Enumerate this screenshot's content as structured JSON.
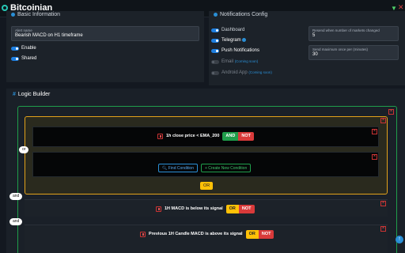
{
  "app": {
    "title": "Bitcoinian"
  },
  "basic": {
    "title": "Basic Information",
    "alert_name_label": "Alert name",
    "alert_name_value": "Bearish MACD on H1 timeframe",
    "enable_label": "Enable",
    "shared_label": "Shared"
  },
  "notif": {
    "title": "Notifications Config",
    "dashboard": "Dashboard",
    "telegram": "Telegram",
    "push": "Push Notifications",
    "email": "Email",
    "android": "Android App",
    "coming_soon": "(Coming soon)",
    "resend_label": "Resend when number of markets changed",
    "resend_value": "5",
    "send_max_label": "Send maximum once per (minutes)",
    "send_max_value": "30"
  },
  "logic": {
    "title": "Logic Builder",
    "or_pill": "or",
    "and_pill_1": "and",
    "and_pill_2": "and",
    "cond1_text": "1h close price < EMA_200",
    "and_label": "AND",
    "not_label": "NOT",
    "or_label": "OR",
    "find_condition": "Find Condition",
    "create_condition": "+ Create New Condition",
    "cond2_text": "1H MACD is below its signal",
    "cond3_text": "Previous 1H Candle MACD is above its signal"
  },
  "colors": {
    "accent": "#2a8fd6",
    "and": "#1f9e4b",
    "not": "#d93a3a",
    "or": "#ffc107"
  }
}
